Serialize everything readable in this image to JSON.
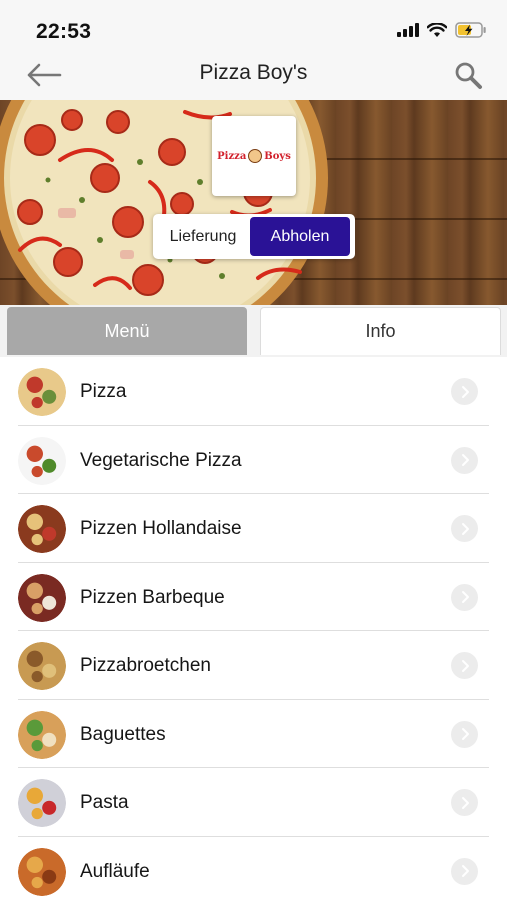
{
  "status_bar": {
    "time": "22:53"
  },
  "nav": {
    "title": "Pizza Boy's",
    "back_icon": "arrow-left-icon",
    "search_icon": "search-icon"
  },
  "hero": {
    "logo_text_left": "Pizza",
    "logo_text_right": "Boys",
    "delivery_label": "Lieferung",
    "pickup_label": "Abholen",
    "selected_mode": "pickup",
    "accent_color": "#2a1296"
  },
  "tabs": [
    {
      "label": "Menü",
      "active": true
    },
    {
      "label": "Info",
      "active": false
    }
  ],
  "categories": [
    {
      "label": "Pizza",
      "thumb": [
        "#e8c98a",
        "#c0392b",
        "#6a8f3a"
      ]
    },
    {
      "label": "Vegetarische Pizza",
      "thumb": [
        "#f5f5f5",
        "#c94a2c",
        "#4f8a2a"
      ]
    },
    {
      "label": "Pizzen Hollandaise",
      "thumb": [
        "#8a3a1e",
        "#e6c27a",
        "#c0392b"
      ]
    },
    {
      "label": "Pizzen Barbeque",
      "thumb": [
        "#7a2a22",
        "#d9a066",
        "#efe6d8"
      ]
    },
    {
      "label": "Pizzabroetchen",
      "thumb": [
        "#c89a52",
        "#8a5a2a",
        "#e0c07a"
      ]
    },
    {
      "label": "Baguettes",
      "thumb": [
        "#d8a05a",
        "#5a9a3a",
        "#f0e0c0"
      ]
    },
    {
      "label": "Pasta",
      "thumb": [
        "#d0d0d8",
        "#e8a838",
        "#c8282a"
      ]
    },
    {
      "label": "Aufläufe",
      "thumb": [
        "#c96a2a",
        "#e6a84a",
        "#8a3a14"
      ]
    }
  ]
}
